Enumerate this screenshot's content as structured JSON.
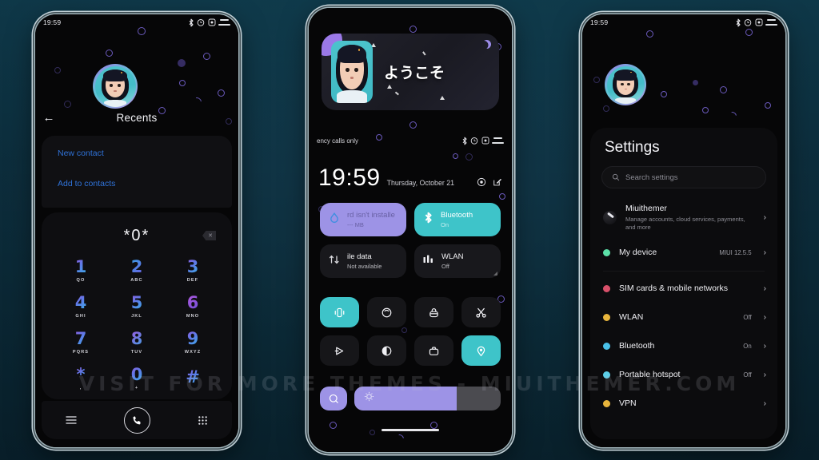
{
  "watermark": "VISIT FOR MORE THEMES - MIUITHEMER.COM",
  "status_bar": {
    "time": "19:59",
    "icons": [
      "bluetooth-icon",
      "alarm-icon",
      "do-not-disturb-icon",
      "battery-icon"
    ]
  },
  "phone1": {
    "name": "dialer-phone",
    "status_time": "19:59",
    "back_icon": "back-arrow-icon",
    "title": "Recents",
    "links": [
      {
        "label": "New contact"
      },
      {
        "label": "Add to contacts"
      }
    ],
    "dialpad": {
      "entry": "*0*",
      "delete_icon": "backspace-icon",
      "keys": [
        {
          "digit": "1",
          "letters": "QO"
        },
        {
          "digit": "2",
          "letters": "ABC"
        },
        {
          "digit": "3",
          "letters": "DEF"
        },
        {
          "digit": "4",
          "letters": "GHI"
        },
        {
          "digit": "5",
          "letters": "JKL"
        },
        {
          "digit": "6",
          "letters": "MNO"
        },
        {
          "digit": "7",
          "letters": "PQRS"
        },
        {
          "digit": "8",
          "letters": "TUV"
        },
        {
          "digit": "9",
          "letters": "WXYZ"
        },
        {
          "digit": "*",
          "letters": ","
        },
        {
          "digit": "0",
          "letters": "+"
        },
        {
          "digit": "#",
          "letters": ""
        }
      ]
    },
    "nav": {
      "menu_icon": "menu-icon",
      "call_icon": "phone-call-icon",
      "keypad_icon": "dialpad-icon"
    }
  },
  "phone2": {
    "name": "lockscreen-phone",
    "widget": {
      "greeting": "ようこそ",
      "avatar": "user-avatar"
    },
    "carrier": "ency calls only",
    "clock": {
      "time": "19:59",
      "date": "Thursday, October 21"
    },
    "clock_icons": [
      "camera-icon",
      "edit-icon"
    ],
    "tiles": [
      {
        "label": "rd isn't installe",
        "sub": "--- MB",
        "icon": "storage-drop-icon",
        "state": "lav"
      },
      {
        "label": "Bluetooth",
        "sub": "On",
        "icon": "bluetooth-icon",
        "state": "teal"
      },
      {
        "label": "ile data",
        "sub": "Not available",
        "icon": "mobile-data-icon",
        "state": "off"
      },
      {
        "label": "WLAN",
        "sub": "Off",
        "icon": "wifi-bars-icon",
        "state": "off"
      }
    ],
    "toggle_icons": [
      {
        "name": "vibrate-icon",
        "on": true
      },
      {
        "name": "flashlight-icon",
        "on": false
      },
      {
        "name": "lock-icon",
        "on": false
      },
      {
        "name": "scissors-screenshot-icon",
        "on": false
      },
      {
        "name": "airplay-cast-icon",
        "on": false
      },
      {
        "name": "dark-mode-icon",
        "on": false
      },
      {
        "name": "briefcase-icon",
        "on": false
      },
      {
        "name": "location-icon",
        "on": true
      }
    ],
    "bottom": {
      "assistant_icon": "assistant-icon",
      "slider_icon": "brightness-icon",
      "slider_percent": 70
    },
    "home_indicator": "home-bar"
  },
  "phone3": {
    "name": "settings-phone",
    "status_time": "19:59",
    "title": "Settings",
    "search": {
      "placeholder": "Search settings",
      "icon": "search-icon"
    },
    "account": {
      "name": "Miuithemer",
      "sub": "Manage accounts, cloud services, payments, and more",
      "icon": "account-avatar",
      "chevron": "chevron-right-icon"
    },
    "rows": [
      {
        "label": "My device",
        "value": "MIUI 12.5.5",
        "color": "#5ce0a8",
        "chevron": "chevron-right-icon"
      },
      {
        "label": "SIM cards & mobile networks",
        "value": "",
        "color": "#d8506a",
        "chevron": "chevron-right-icon"
      },
      {
        "label": "WLAN",
        "value": "Off",
        "color": "#e8b53c",
        "chevron": "chevron-right-icon"
      },
      {
        "label": "Bluetooth",
        "value": "On",
        "color": "#49c0e8",
        "chevron": "chevron-right-icon"
      },
      {
        "label": "Portable hotspot",
        "value": "Off",
        "color": "#5ccfe8",
        "chevron": "chevron-right-icon"
      },
      {
        "label": "VPN",
        "value": "",
        "color": "#e8b53c",
        "chevron": "chevron-right-icon"
      }
    ]
  },
  "colors": {
    "accent_teal": "#3ec4c9",
    "accent_lavender": "#9d93e6",
    "link_blue": "#2f72d8",
    "bubble_purple": "#7c68dc",
    "backdrop": "#0d2f3e"
  }
}
